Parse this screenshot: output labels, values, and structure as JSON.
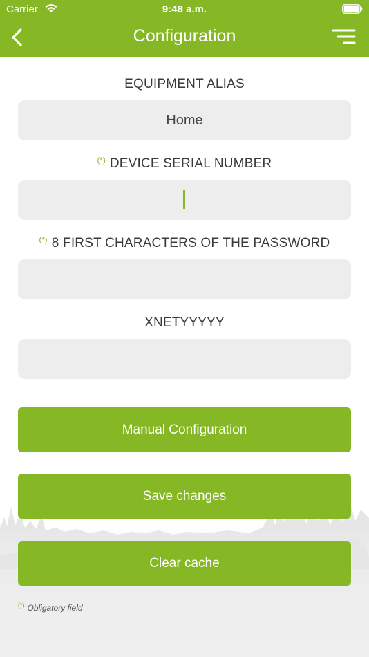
{
  "status_bar": {
    "carrier": "Carrier",
    "time": "9:48 a.m."
  },
  "nav": {
    "title": "Configuration"
  },
  "form": {
    "required_marker": "(*)",
    "equipment_alias": {
      "label": "EQUIPMENT ALIAS",
      "value": "Home"
    },
    "serial_number": {
      "label": "DEVICE SERIAL NUMBER",
      "value": ""
    },
    "password": {
      "label": "8 FIRST CHARACTERS OF THE PASSWORD",
      "value": ""
    },
    "xnet": {
      "label": "XNETYYYYY",
      "value": ""
    }
  },
  "buttons": {
    "manual_configuration": "Manual Configuration",
    "save_changes": "Save changes",
    "clear_cache": "Clear cache"
  },
  "footnote": {
    "marker": "(*)",
    "text": "Obligatory field"
  },
  "colors": {
    "accent": "#86b725",
    "input_bg": "#ededed"
  }
}
